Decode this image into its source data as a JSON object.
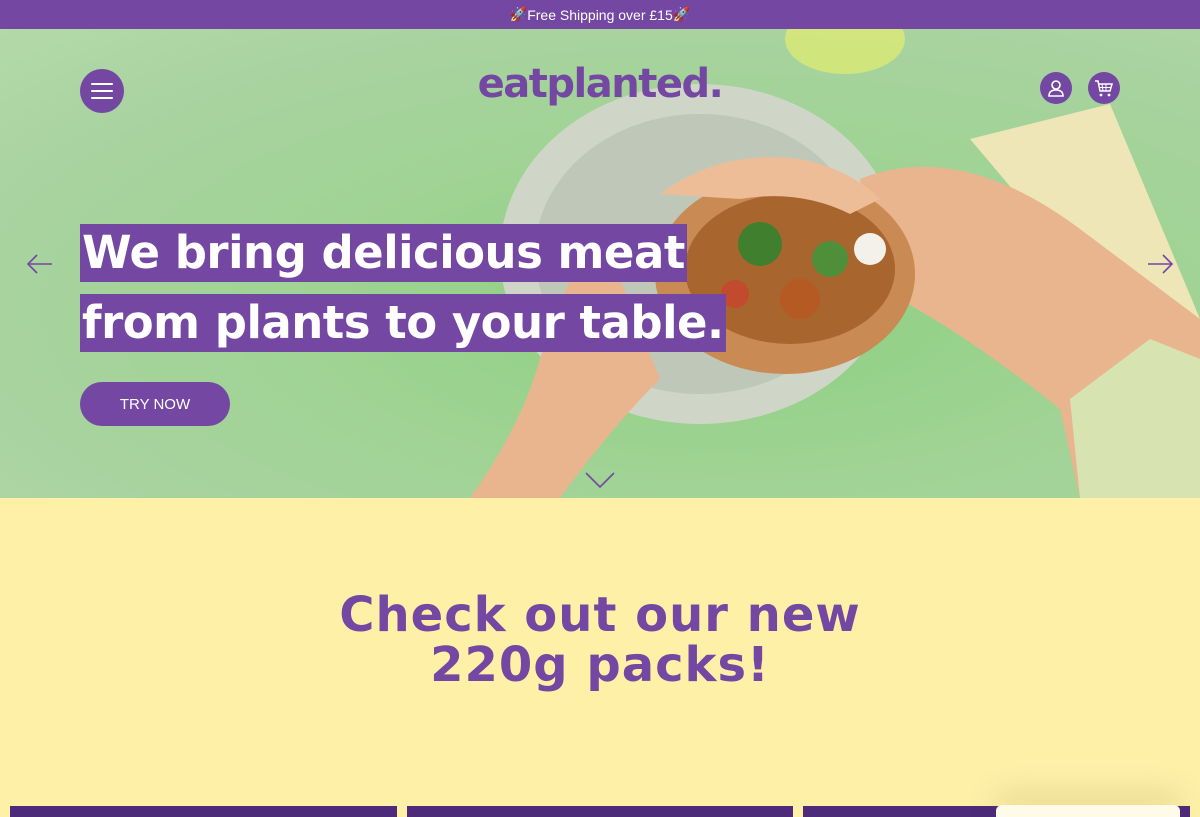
{
  "promo": {
    "text": "Free Shipping over £15",
    "rocket_left": "🚀",
    "rocket_right": "🚀"
  },
  "header": {
    "logo": "eatplanted.",
    "menu_icon": "hamburger-icon",
    "account_icon": "user-icon",
    "cart_icon": "cart-icon"
  },
  "hero": {
    "headline_line1": "We bring delicious meat",
    "headline_line2": "from plants to your table.",
    "cta_label": "TRY NOW",
    "prev_icon": "arrow-left-icon",
    "next_icon": "arrow-right-icon",
    "scroll_icon": "chevron-down-icon"
  },
  "packs": {
    "title_line1": "Check out our new",
    "title_line2": "220g packs!"
  },
  "colors": {
    "brand": "#7347a2",
    "hero_bg": "#a9d3a0",
    "section_bg": "#fff0a8",
    "card": "#4d2a7a"
  }
}
